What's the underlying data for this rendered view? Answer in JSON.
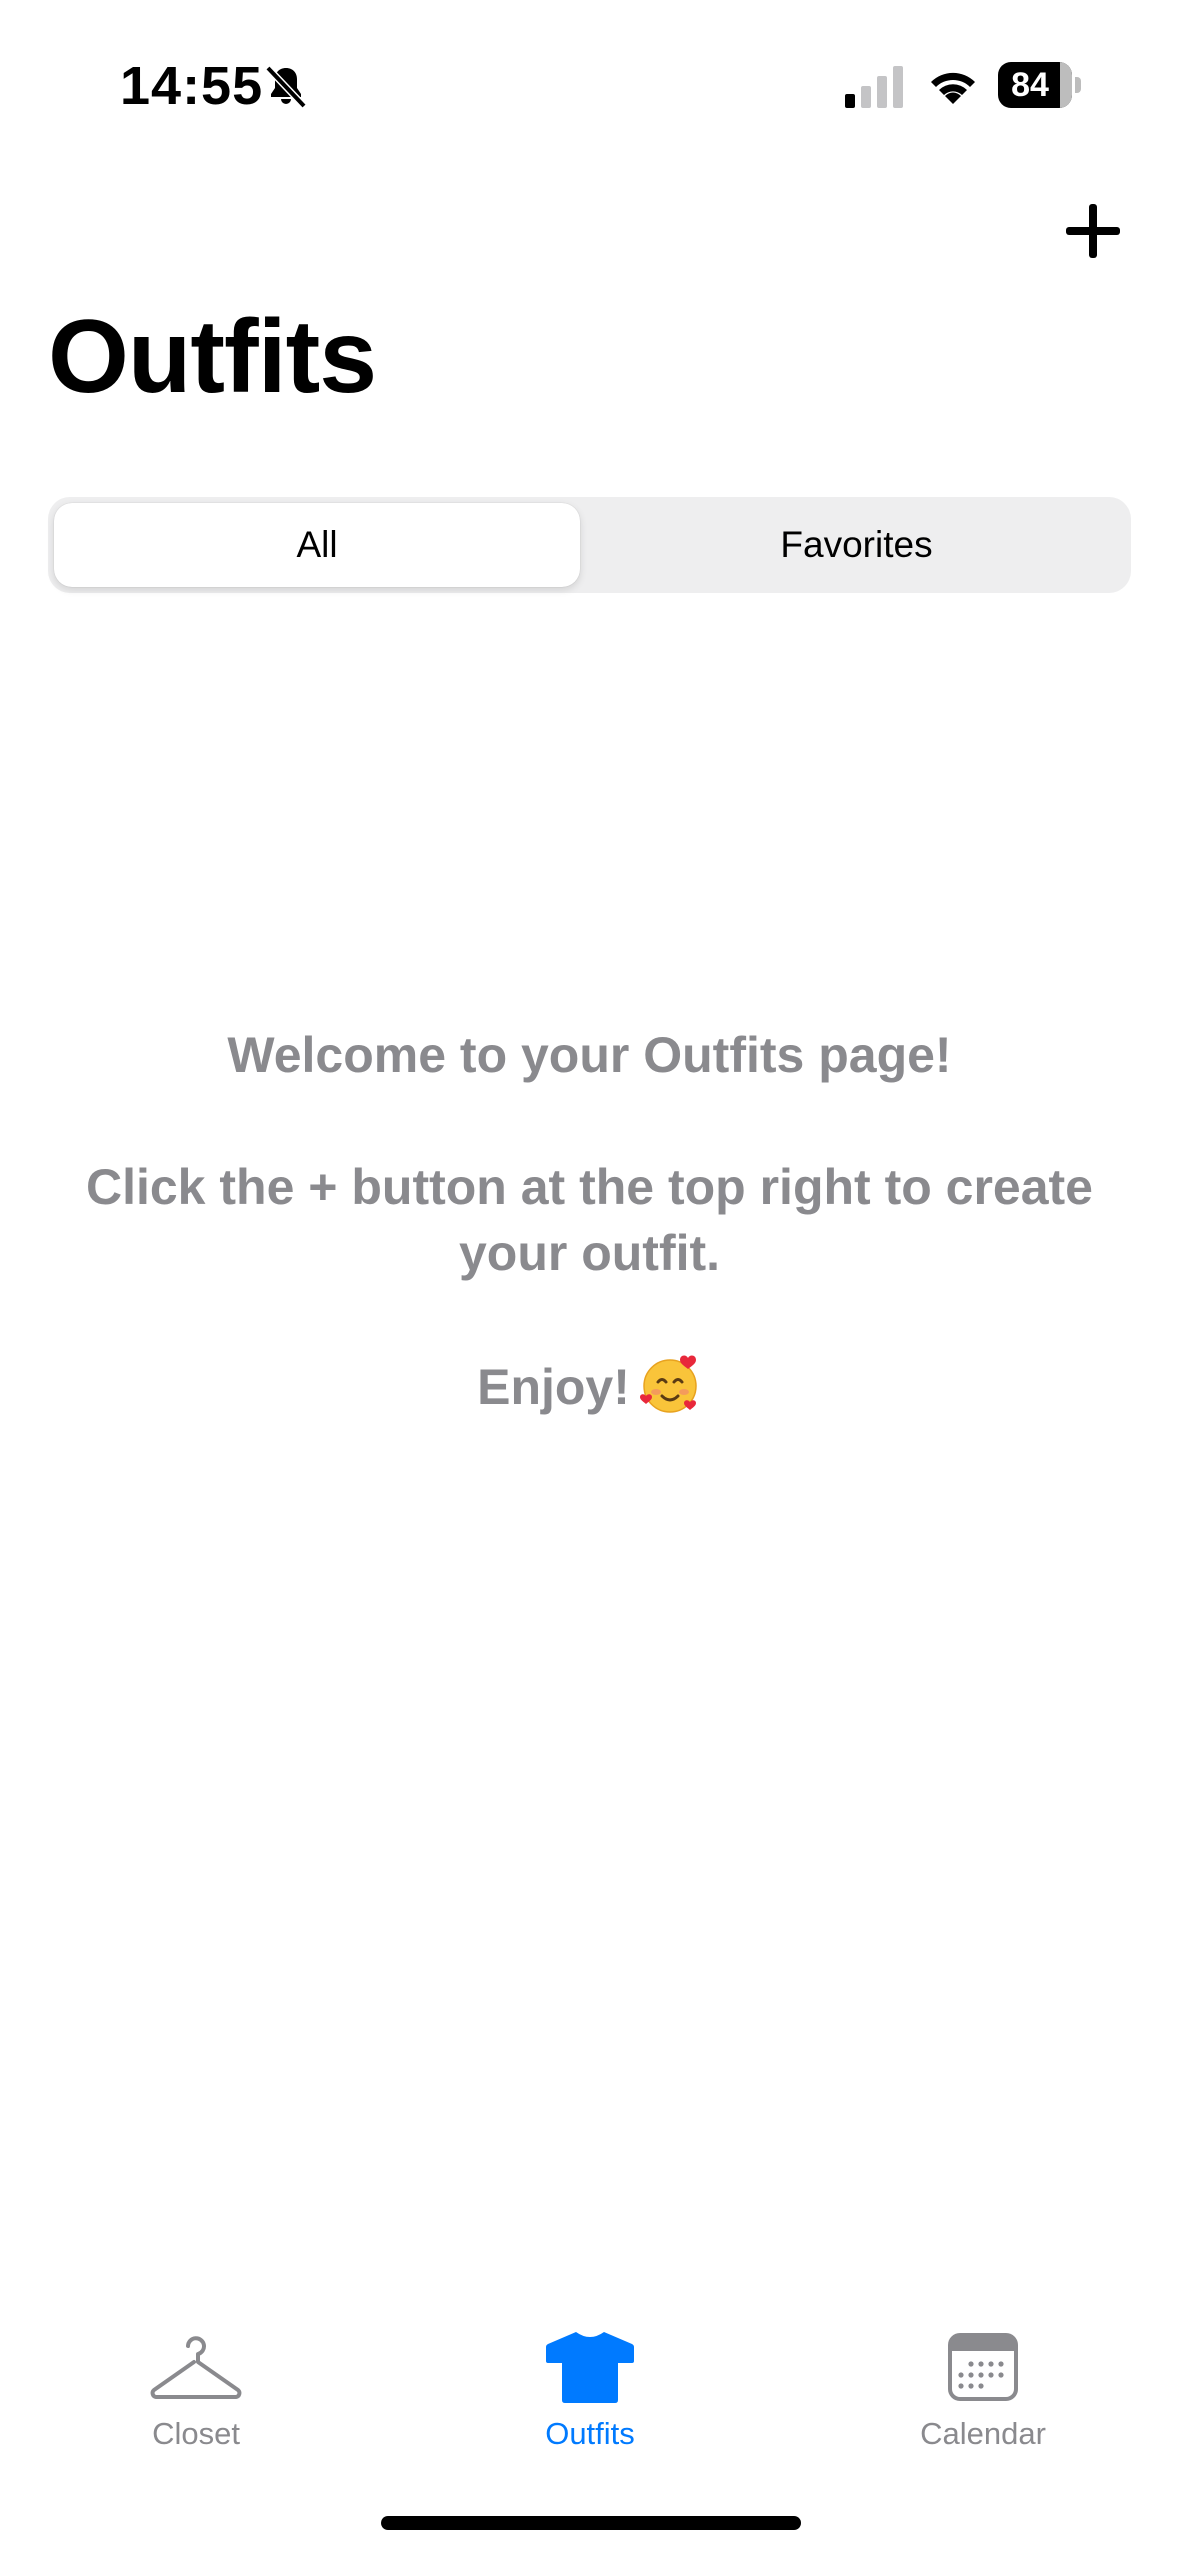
{
  "status_bar": {
    "time": "14:55",
    "battery_level": "84",
    "icons": [
      "bell-slash-icon",
      "cellular-signal-icon",
      "wifi-icon",
      "battery-icon"
    ]
  },
  "header": {
    "add_icon": "plus-icon",
    "title": "Outfits"
  },
  "segments": {
    "all_label": "All",
    "favorites_label": "Favorites",
    "selected": "All"
  },
  "empty_state": {
    "line1": "Welcome to your Outfits page!",
    "line2": "Click the + button at the top right to create your outfit.",
    "line3": "Enjoy!",
    "emoji_icon": "smiling-face-with-hearts-icon"
  },
  "tab_bar": {
    "items": [
      {
        "label": "Closet",
        "icon": "hanger-icon"
      },
      {
        "label": "Outfits",
        "icon": "tshirt-icon"
      },
      {
        "label": "Calendar",
        "icon": "calendar-icon"
      }
    ],
    "selected": "Outfits"
  },
  "colors": {
    "accent": "#007aff",
    "inactive": "#8a8a8e",
    "empty_text": "#8a8a8e",
    "segment_bg": "#eeeeef"
  }
}
